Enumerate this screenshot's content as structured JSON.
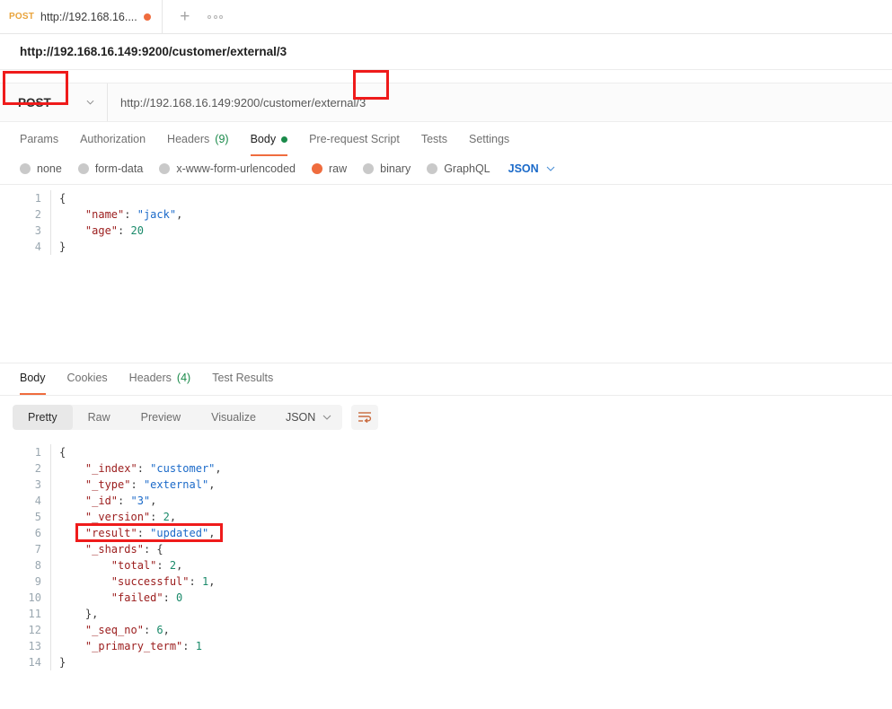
{
  "tabbar": {
    "tab": {
      "method": "POST",
      "title": "http://192.168.16....",
      "dirty_indicator": "unsaved-dot"
    },
    "new_tab_icon": "plus-icon",
    "more_icon": "ellipsis-icon"
  },
  "request": {
    "title": "http://192.168.16.149:9200/customer/external/3",
    "method": "POST",
    "url": "http://192.168.16.149:9200/customer/external/3",
    "tabs": [
      {
        "label": "Params",
        "active": false
      },
      {
        "label": "Authorization",
        "active": false
      },
      {
        "label": "Headers",
        "count": "(9)",
        "active": false
      },
      {
        "label": "Body",
        "active": true,
        "dot": true
      },
      {
        "label": "Pre-request Script",
        "active": false
      },
      {
        "label": "Tests",
        "active": false
      },
      {
        "label": "Settings",
        "active": false
      }
    ],
    "body_types": [
      {
        "label": "none",
        "selected": false
      },
      {
        "label": "form-data",
        "selected": false
      },
      {
        "label": "x-www-form-urlencoded",
        "selected": false
      },
      {
        "label": "raw",
        "selected": true
      },
      {
        "label": "binary",
        "selected": false
      },
      {
        "label": "GraphQL",
        "selected": false
      }
    ],
    "format": "JSON",
    "body_lines": [
      {
        "no": "1",
        "tokens": [
          {
            "t": "{",
            "c": "p"
          }
        ]
      },
      {
        "no": "2",
        "tokens": [
          {
            "t": "    ",
            "c": "ind"
          },
          {
            "t": "\"name\"",
            "c": "k"
          },
          {
            "t": ": ",
            "c": "p"
          },
          {
            "t": "\"jack\"",
            "c": "s"
          },
          {
            "t": ",",
            "c": "p"
          }
        ]
      },
      {
        "no": "3",
        "tokens": [
          {
            "t": "    ",
            "c": "ind"
          },
          {
            "t": "\"age\"",
            "c": "k"
          },
          {
            "t": ": ",
            "c": "p"
          },
          {
            "t": "20",
            "c": "n"
          }
        ]
      },
      {
        "no": "4",
        "tokens": [
          {
            "t": "}",
            "c": "p"
          }
        ]
      }
    ]
  },
  "response": {
    "tabs": [
      {
        "label": "Body",
        "active": true
      },
      {
        "label": "Cookies",
        "active": false
      },
      {
        "label": "Headers",
        "count": "(4)",
        "active": false
      },
      {
        "label": "Test Results",
        "active": false
      }
    ],
    "view_modes": [
      {
        "label": "Pretty",
        "active": true
      },
      {
        "label": "Raw",
        "active": false
      },
      {
        "label": "Preview",
        "active": false
      },
      {
        "label": "Visualize",
        "active": false
      }
    ],
    "format": "JSON",
    "wrap_icon": "wrap-text-icon",
    "body_lines": [
      {
        "no": "1",
        "tokens": [
          {
            "t": "{",
            "c": "p"
          }
        ]
      },
      {
        "no": "2",
        "tokens": [
          {
            "t": "    ",
            "c": "ind"
          },
          {
            "t": "\"_index\"",
            "c": "k"
          },
          {
            "t": ": ",
            "c": "p"
          },
          {
            "t": "\"customer\"",
            "c": "s"
          },
          {
            "t": ",",
            "c": "p"
          }
        ]
      },
      {
        "no": "3",
        "tokens": [
          {
            "t": "    ",
            "c": "ind"
          },
          {
            "t": "\"_type\"",
            "c": "k"
          },
          {
            "t": ": ",
            "c": "p"
          },
          {
            "t": "\"external\"",
            "c": "s"
          },
          {
            "t": ",",
            "c": "p"
          }
        ]
      },
      {
        "no": "4",
        "tokens": [
          {
            "t": "    ",
            "c": "ind"
          },
          {
            "t": "\"_id\"",
            "c": "k"
          },
          {
            "t": ": ",
            "c": "p"
          },
          {
            "t": "\"3\"",
            "c": "s"
          },
          {
            "t": ",",
            "c": "p"
          }
        ]
      },
      {
        "no": "5",
        "tokens": [
          {
            "t": "    ",
            "c": "ind"
          },
          {
            "t": "\"_version\"",
            "c": "k"
          },
          {
            "t": ": ",
            "c": "p"
          },
          {
            "t": "2",
            "c": "n"
          },
          {
            "t": ",",
            "c": "p"
          }
        ]
      },
      {
        "no": "6",
        "tokens": [
          {
            "t": "    ",
            "c": "ind"
          },
          {
            "t": "\"result\"",
            "c": "k"
          },
          {
            "t": ": ",
            "c": "p"
          },
          {
            "t": "\"updated\"",
            "c": "s"
          },
          {
            "t": ",",
            "c": "p"
          }
        ]
      },
      {
        "no": "7",
        "tokens": [
          {
            "t": "    ",
            "c": "ind"
          },
          {
            "t": "\"_shards\"",
            "c": "k"
          },
          {
            "t": ": ",
            "c": "p"
          },
          {
            "t": "{",
            "c": "p"
          }
        ]
      },
      {
        "no": "8",
        "tokens": [
          {
            "t": "        ",
            "c": "ind"
          },
          {
            "t": "\"total\"",
            "c": "k"
          },
          {
            "t": ": ",
            "c": "p"
          },
          {
            "t": "2",
            "c": "n"
          },
          {
            "t": ",",
            "c": "p"
          }
        ]
      },
      {
        "no": "9",
        "tokens": [
          {
            "t": "        ",
            "c": "ind"
          },
          {
            "t": "\"successful\"",
            "c": "k"
          },
          {
            "t": ": ",
            "c": "p"
          },
          {
            "t": "1",
            "c": "n"
          },
          {
            "t": ",",
            "c": "p"
          }
        ]
      },
      {
        "no": "10",
        "tokens": [
          {
            "t": "        ",
            "c": "ind"
          },
          {
            "t": "\"failed\"",
            "c": "k"
          },
          {
            "t": ": ",
            "c": "p"
          },
          {
            "t": "0",
            "c": "n"
          }
        ]
      },
      {
        "no": "11",
        "tokens": [
          {
            "t": "    ",
            "c": "ind"
          },
          {
            "t": "},",
            "c": "p"
          }
        ]
      },
      {
        "no": "12",
        "tokens": [
          {
            "t": "    ",
            "c": "ind"
          },
          {
            "t": "\"_seq_no\"",
            "c": "k"
          },
          {
            "t": ": ",
            "c": "p"
          },
          {
            "t": "6",
            "c": "n"
          },
          {
            "t": ",",
            "c": "p"
          }
        ]
      },
      {
        "no": "13",
        "tokens": [
          {
            "t": "    ",
            "c": "ind"
          },
          {
            "t": "\"_primary_term\"",
            "c": "k"
          },
          {
            "t": ": ",
            "c": "p"
          },
          {
            "t": "1",
            "c": "n"
          }
        ]
      },
      {
        "no": "14",
        "tokens": [
          {
            "t": "}",
            "c": "p"
          }
        ]
      }
    ]
  },
  "annotations": [
    {
      "name": "method-highlight",
      "color": "#ef1b1b"
    },
    {
      "name": "resource-id-highlight",
      "color": "#ef1b1b"
    },
    {
      "name": "result-field-highlight",
      "color": "#ef1b1b"
    }
  ],
  "colors": {
    "accent_orange": "#ef6c3e",
    "method_post": "#e9a33a",
    "green_count": "#1a8a4a",
    "link_blue": "#1b6ac9",
    "annotation_red": "#ef1b1b"
  }
}
